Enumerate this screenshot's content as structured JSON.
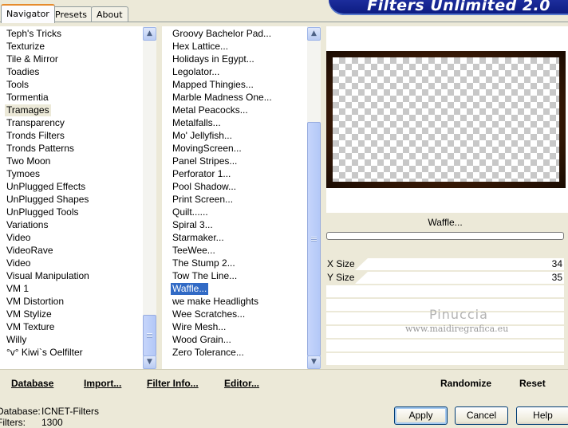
{
  "tabs": [
    "Navigator",
    "Presets",
    "About"
  ],
  "app_title": "Filters Unlimited 2.0",
  "categories": [
    "Teph's Tricks",
    "Texturize",
    "Tile & Mirror",
    "Toadies",
    "Tools",
    "Tormentia",
    "Tramages",
    "Transparency",
    "Tronds Filters",
    "Tronds Patterns",
    "Two Moon",
    "Tymoes",
    "UnPlugged Effects",
    "UnPlugged Shapes",
    "UnPlugged Tools",
    "Variations",
    "Video",
    "VideoRave",
    "Video",
    "Visual Manipulation",
    "VM 1",
    "VM Distortion",
    "VM Stylize",
    "VM Texture",
    "Willy",
    "°v° Kiwi`s Oelfilter"
  ],
  "selected_category": "Tramages",
  "filters": [
    "Groovy Bachelor Pad...",
    "Hex Lattice...",
    "Holidays in Egypt...",
    "Legolator...",
    "Mapped Thingies...",
    "Marble Madness One...",
    "Metal Peacocks...",
    "Metalfalls...",
    "Mo' Jellyfish...",
    "MovingScreen...",
    "Panel Stripes...",
    "Perforator 1...",
    "Pool Shadow...",
    "Print Screen...",
    "Quilt......",
    "Spiral 3...",
    "Starmaker...",
    "TeeWee...",
    "The Stump 2...",
    "Tow The Line...",
    "Waffle...",
    "we make Headlights",
    "Wee Scratches...",
    "Wire Mesh...",
    "Wood Grain...",
    "Zero Tolerance..."
  ],
  "selected_filter": "Waffle...",
  "preview": {
    "filter_name": "Waffle..."
  },
  "params": [
    {
      "label": "X Size:",
      "value": "34"
    },
    {
      "label": "Y Size:",
      "value": "35"
    }
  ],
  "watermark": {
    "line1": "Pinuccia",
    "line2": "www.maidiregrafica.eu"
  },
  "toolbar": {
    "database": "Database",
    "import": "Import...",
    "filter_info": "Filter Info...",
    "editor": "Editor...",
    "randomize": "Randomize",
    "reset": "Reset"
  },
  "status": {
    "database_label": "Database:",
    "database_value": "ICNET-Filters",
    "filters_label": "Filters:",
    "filters_value": "1300"
  },
  "buttons": {
    "apply": "Apply",
    "cancel": "Cancel",
    "help": "Help"
  },
  "colors": {
    "banner": "#0b1a7e",
    "selection": "#316ac5",
    "tab_accent": "#e68b2c"
  }
}
